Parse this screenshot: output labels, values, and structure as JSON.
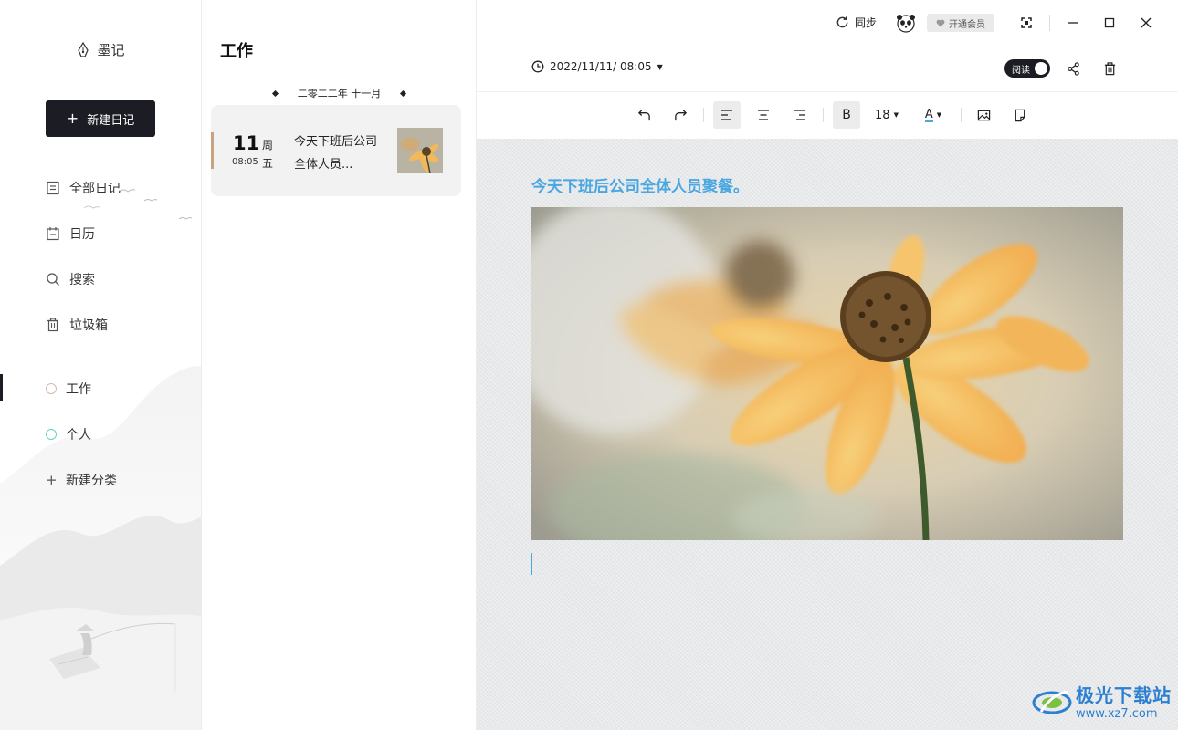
{
  "sidebar": {
    "logo_text": "墨记",
    "new_diary_label": "新建日记",
    "nav": [
      {
        "label": "全部日记",
        "icon": "document-icon"
      },
      {
        "label": "日历",
        "icon": "calendar-icon"
      },
      {
        "label": "搜索",
        "icon": "search-icon"
      },
      {
        "label": "垃圾箱",
        "icon": "trash-icon"
      }
    ],
    "categories": [
      {
        "label": "工作",
        "color": "#d9b8aa",
        "active": true
      },
      {
        "label": "个人",
        "color": "#5fd4c4",
        "active": false
      }
    ],
    "new_category_label": "新建分类"
  },
  "list": {
    "title": "工作",
    "month_header": "二零二二年 十一月",
    "entries": [
      {
        "day": "11",
        "week_line1": "周",
        "week_line2": "五",
        "time": "08:05",
        "preview": "今天下班后公司全体人员..."
      }
    ]
  },
  "topbar": {
    "sync_label": "同步",
    "vip_label": "开通会员"
  },
  "editor": {
    "date": "2022/11/11/ 08:05",
    "read_toggle_label": "阅读",
    "font_size": "18",
    "font_color_label": "A",
    "bold_label": "B",
    "headline": "今天下班后公司全体人员聚餐。",
    "accent_color": "#4aa7e0"
  },
  "watermark": {
    "brand": "极光下载站",
    "url": "www.xz7.com"
  }
}
